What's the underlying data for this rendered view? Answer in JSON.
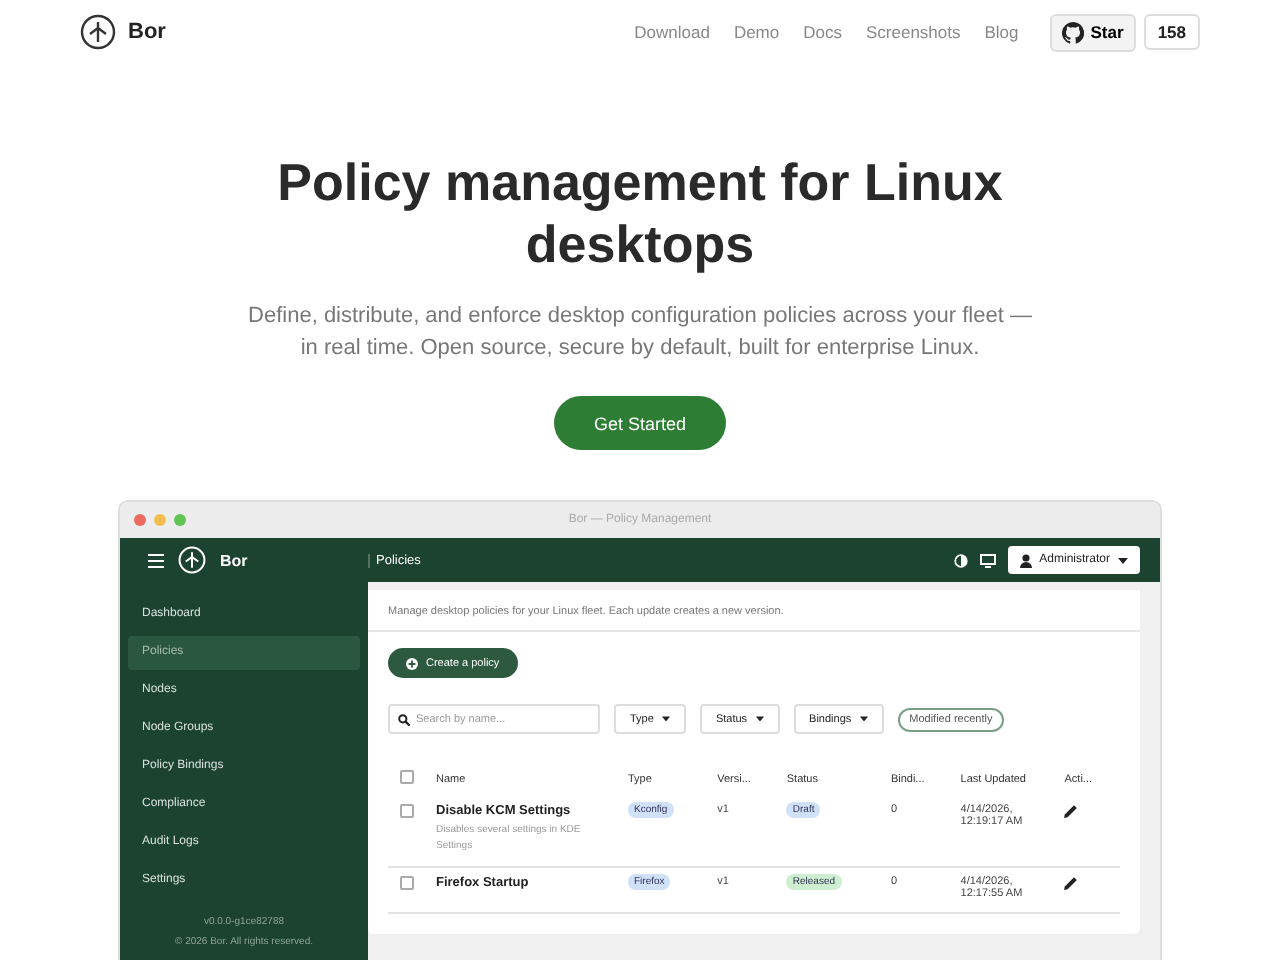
{
  "nav": {
    "brand": "Bor",
    "links": [
      "Download",
      "Demo",
      "Docs",
      "Screenshots",
      "Blog"
    ],
    "star": "Star",
    "star_count": "158"
  },
  "hero": {
    "title": "Policy management for Linux desktops",
    "subtitle": "Define, distribute, and enforce desktop configuration policies across your fleet — in real time. Open source, secure by default, built for enterprise Linux.",
    "cta": "Get Started"
  },
  "app": {
    "window_title": "Bor — Policy Management",
    "brand": "Bor",
    "page": "Policies",
    "user": "Administrator",
    "sidebar": {
      "items": [
        {
          "label": "Dashboard",
          "selected": false
        },
        {
          "label": "Policies",
          "selected": true
        },
        {
          "label": "Nodes",
          "selected": false
        },
        {
          "label": "Node Groups",
          "selected": false
        },
        {
          "label": "Policy Bindings",
          "selected": false
        },
        {
          "label": "Compliance",
          "selected": false
        },
        {
          "label": "Audit Logs",
          "selected": false
        },
        {
          "label": "Settings",
          "selected": false
        }
      ],
      "version": "v0.0.0-g1ce82788",
      "copyright": "© 2026 Bor. All rights reserved."
    },
    "description": "Manage desktop policies for your Linux fleet. Each update creates a new version.",
    "create_button": "Create a policy",
    "search": {
      "placeholder": "Search by name..."
    },
    "filters": [
      "Type",
      "Status",
      "Bindings"
    ],
    "sort_chip": "Modified recently",
    "table": {
      "select_all_checked": false,
      "columns": [
        "Name",
        "Type",
        "Versi...",
        "Status",
        "Bindi...",
        "Last Updated",
        "Acti..."
      ],
      "rows": [
        {
          "name": "Disable KCM Settings",
          "description": "Disables several settings in KDE Settings",
          "type": "Kconfig",
          "version": "v1",
          "status": "Draft",
          "color": "#cfe0f7",
          "bindings": "0",
          "updated": "4/14/2026, 12:19:17 AM",
          "checked": false
        },
        {
          "name": "Firefox Startup",
          "type": "Firefox",
          "version": "v1",
          "status": "Released",
          "color": "#cdeecf",
          "bindings": "0",
          "updated": "4/14/2026, 12:17:55 AM",
          "checked": false
        }
      ]
    }
  }
}
